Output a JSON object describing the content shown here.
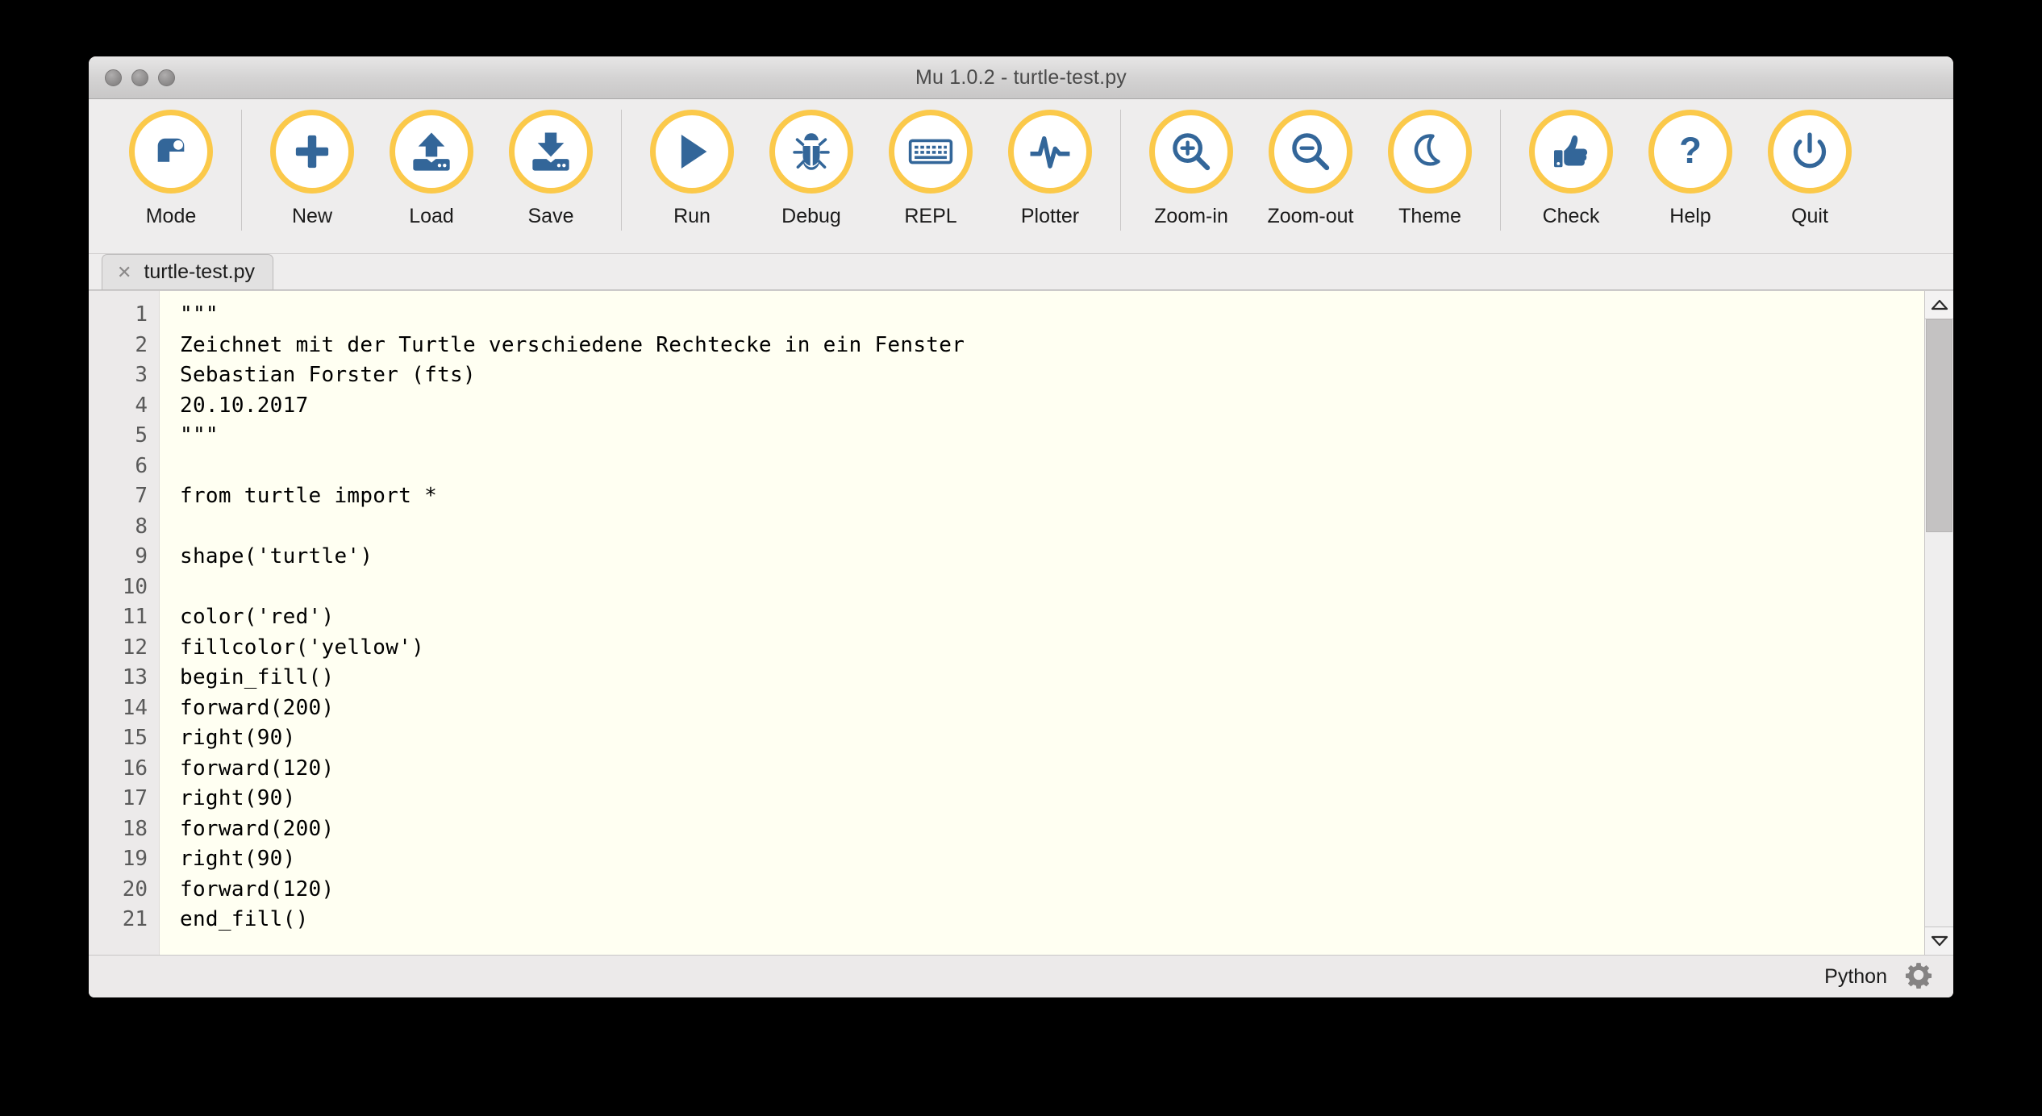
{
  "window": {
    "title": "Mu 1.0.2 - turtle-test.py",
    "traffic_lights": [
      "close",
      "minimize",
      "zoom"
    ]
  },
  "toolbar": {
    "groups": [
      {
        "items": [
          {
            "label": "Mode",
            "icon": "turtle-mode-icon"
          }
        ]
      },
      {
        "items": [
          {
            "label": "New",
            "icon": "plus-icon"
          },
          {
            "label": "Load",
            "icon": "upload-icon"
          },
          {
            "label": "Save",
            "icon": "download-icon"
          }
        ]
      },
      {
        "items": [
          {
            "label": "Run",
            "icon": "play-icon"
          },
          {
            "label": "Debug",
            "icon": "bug-icon"
          },
          {
            "label": "REPL",
            "icon": "keyboard-icon"
          },
          {
            "label": "Plotter",
            "icon": "waveform-icon"
          }
        ]
      },
      {
        "items": [
          {
            "label": "Zoom-in",
            "icon": "magnifier-plus-icon"
          },
          {
            "label": "Zoom-out",
            "icon": "magnifier-minus-icon"
          },
          {
            "label": "Theme",
            "icon": "moon-icon"
          }
        ]
      },
      {
        "items": [
          {
            "label": "Check",
            "icon": "thumbs-up-icon"
          },
          {
            "label": "Help",
            "icon": "question-mark-icon"
          },
          {
            "label": "Quit",
            "icon": "power-icon"
          }
        ]
      }
    ],
    "accent_color": "#fbc94a",
    "icon_color": "#336699"
  },
  "tabs": [
    {
      "label": "turtle-test.py",
      "close_glyph": "✕",
      "active": true
    }
  ],
  "editor": {
    "first_line_number": 1,
    "lines": [
      {
        "n": "1",
        "text": "\"\"\""
      },
      {
        "n": "2",
        "text": "Zeichnet mit der Turtle verschiedene Rechtecke in ein Fenster"
      },
      {
        "n": "3",
        "text": "Sebastian Forster (fts)"
      },
      {
        "n": "4",
        "text": "20.10.2017"
      },
      {
        "n": "5",
        "text": "\"\"\""
      },
      {
        "n": "6",
        "text": ""
      },
      {
        "n": "7",
        "text": "from turtle import *"
      },
      {
        "n": "8",
        "text": ""
      },
      {
        "n": "9",
        "text": "shape('turtle')"
      },
      {
        "n": "10",
        "text": ""
      },
      {
        "n": "11",
        "text": "color('red')"
      },
      {
        "n": "12",
        "text": "fillcolor('yellow')"
      },
      {
        "n": "13",
        "text": "begin_fill()"
      },
      {
        "n": "14",
        "text": "forward(200)"
      },
      {
        "n": "15",
        "text": "right(90)"
      },
      {
        "n": "16",
        "text": "forward(120)"
      },
      {
        "n": "17",
        "text": "right(90)"
      },
      {
        "n": "18",
        "text": "forward(200)"
      },
      {
        "n": "19",
        "text": "right(90)"
      },
      {
        "n": "20",
        "text": "forward(120)"
      },
      {
        "n": "21",
        "text": "end_fill()"
      }
    ],
    "background": "#fffff2",
    "text_color": "#000000",
    "gutter_background": "#eceaea"
  },
  "scrollbar": {
    "up_glyph": "△",
    "down_glyph": "▽",
    "thumb_top_percent": 0,
    "thumb_height_percent": 35
  },
  "statusbar": {
    "mode_label": "Python",
    "settings_icon": "gear-icon"
  }
}
